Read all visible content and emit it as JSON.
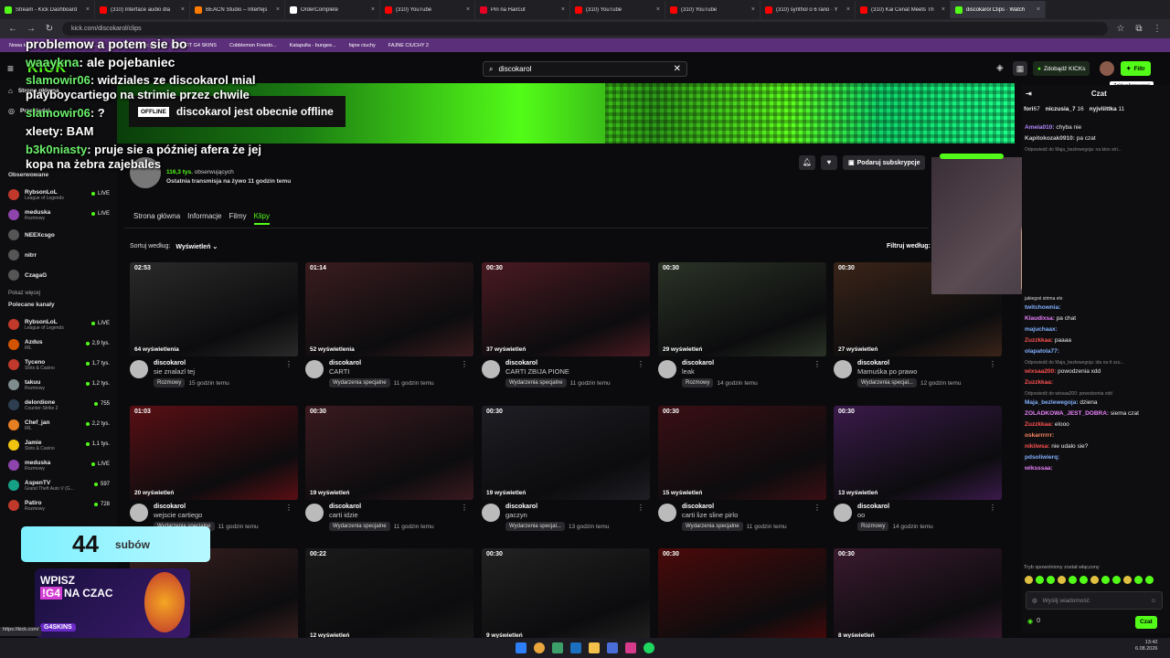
{
  "browser": {
    "tabs": [
      {
        "title": "Stream - Kick Dashboard",
        "color": "#53fc18"
      },
      {
        "title": "(310) Interface audio dla",
        "color": "#ff0000"
      },
      {
        "title": "BEACN Studio – Interfejs",
        "color": "#ff7a00"
      },
      {
        "title": "OrderComplete",
        "color": "#ffffff"
      },
      {
        "title": "(310) YouTube",
        "color": "#ff0000"
      },
      {
        "title": "Pin na Haircut",
        "color": "#e60023"
      },
      {
        "title": "(310) YouTube",
        "color": "#ff0000"
      },
      {
        "title": "(310) YouTube",
        "color": "#ff0000"
      },
      {
        "title": "(310) synthol o 6 rano · Y",
        "color": "#ff0000"
      },
      {
        "title": "(310) Kai Cenat Meets Th",
        "color": "#ff0000"
      },
      {
        "title": "discokarol Clips · Watch",
        "color": "#53fc18",
        "active": true
      }
    ],
    "url": "kick.com/discokarol/clips",
    "bookmarks": [
      "Nowa karta",
      "(644) G SHOCK HO...",
      "Imgur: The magic of...",
      "RAPORT G4 SKINS",
      "Cobblemon Freedo...",
      "Katapulta - bungee...",
      "fajne ciuchy",
      "FAJNE CIUCHY 2"
    ]
  },
  "header": {
    "logo": "KICK",
    "search_value": "discokarol",
    "subscribe_label": "Zdobądź KICKs",
    "filter_label": "Filtr",
    "tooltip": "Zaktualizowano!"
  },
  "sidebar": {
    "home": "Strona główna",
    "browse": "Przeglądaj",
    "following_label": "Obserwowane",
    "followed": [
      {
        "name": "RybsonLoL",
        "sub": "League of Legends",
        "status": "LIVE",
        "color": "#c0392b"
      },
      {
        "name": "meduska",
        "sub": "Rozmowy",
        "status": "LIVE",
        "color": "#8e44ad"
      },
      {
        "name": "NEEXcsgo",
        "sub": "",
        "status": "",
        "color": "#555"
      },
      {
        "name": "nitrr",
        "sub": "",
        "status": "",
        "color": "#555"
      },
      {
        "name": "CzagaG",
        "sub": "",
        "status": "",
        "color": "#555"
      }
    ],
    "show_more": "Pokaż więcej",
    "recommended_label": "Polecane kanały",
    "recommended": [
      {
        "name": "RybsonLoL",
        "sub": "League of Legends",
        "status": "LIVE",
        "color": "#c0392b"
      },
      {
        "name": "Azdus",
        "sub": "IRL",
        "status": "2,9 tys.",
        "color": "#d35400"
      },
      {
        "name": "Tyceno",
        "sub": "Slots & Casino",
        "status": "1,7 tys.",
        "color": "#c0392b"
      },
      {
        "name": "takuu",
        "sub": "Rozmowy",
        "status": "1,2 tys.",
        "color": "#7f8c8d"
      },
      {
        "name": "delordione",
        "sub": "Counter-Strike 2",
        "status": "755",
        "color": "#2c3e50"
      },
      {
        "name": "Chef_jan",
        "sub": "IRL",
        "status": "2,2 tys.",
        "color": "#e67e22"
      },
      {
        "name": "Jamie",
        "sub": "Slots & Casino",
        "status": "1,1 tys.",
        "color": "#f1c40f"
      },
      {
        "name": "meduska",
        "sub": "Rozmowy",
        "status": "LIVE",
        "color": "#8e44ad"
      },
      {
        "name": "AspenTV",
        "sub": "Grand Theft Auto V (G...",
        "status": "597",
        "color": "#16a085"
      },
      {
        "name": "Patiro",
        "sub": "Rozmowy",
        "status": "728",
        "color": "#c0392b"
      }
    ],
    "show_more2": "Pokaż"
  },
  "channel": {
    "offline_tag": "OFFLINE",
    "offline_text": "discokarol jest obecnie offline",
    "followers": "116,3 tys.",
    "followers_label": "obserwujących",
    "last_stream": "Ostatnia transmisja na żywo 11 godzin temu",
    "gift_label": "Podaruj subskrypcje"
  },
  "tabs": [
    "Strona główna",
    "Informacje",
    "Filmy",
    "Klipy"
  ],
  "sort": {
    "label": "Sortuj według:",
    "value": "Wyświetleń",
    "filter": "Filtruj według:"
  },
  "clips": [
    {
      "dur": "02:53",
      "views": "64 wyświetlenia",
      "channel": "discokarol",
      "title": "sie znalazl tej",
      "cat": "Rozmowy",
      "time": "15 godzin temu",
      "bg": "#2a2a2a"
    },
    {
      "dur": "01:14",
      "views": "52 wyświetlenia",
      "channel": "discokarol",
      "title": "CARTI",
      "cat": "Wydarzenia specjalne",
      "time": "11 godzin temu",
      "bg": "#3a1c1f"
    },
    {
      "dur": "00:30",
      "views": "37 wyświetleń",
      "channel": "discokarol",
      "title": "CARTI ZBIJA PIONE",
      "cat": "Wydarzenia specjalne",
      "time": "11 godzin temu",
      "bg": "#4a1a22"
    },
    {
      "dur": "00:30",
      "views": "29 wyświetleń",
      "channel": "discokarol",
      "title": "leak",
      "cat": "Rozmowy",
      "time": "14 godzin temu",
      "bg": "#2b3326"
    },
    {
      "dur": "00:30",
      "views": "27 wyświetleń",
      "channel": "discokarol",
      "title": "Mamuśka po prawo",
      "cat": "Wydarzenia specjal...",
      "time": "12 godzin temu",
      "bg": "#3a2418"
    },
    {
      "dur": "01:03",
      "views": "20 wyświetleń",
      "channel": "discokarol",
      "title": "wejscie cartiego",
      "cat": "Wydarzenia specjalne",
      "time": "11 godzin temu",
      "bg": "#5a0f14"
    },
    {
      "dur": "00:30",
      "views": "19 wyświetleń",
      "channel": "discokarol",
      "title": "carti idzie",
      "cat": "Wydarzenia specjalne",
      "time": "11 godzin temu",
      "bg": "#3a1a20"
    },
    {
      "dur": "00:30",
      "views": "19 wyświetleń",
      "channel": "discokarol",
      "title": "gaczyn",
      "cat": "Wydarzenia specjal...",
      "time": "13 godzin temu",
      "bg": "#1e1e24"
    },
    {
      "dur": "00:30",
      "views": "15 wyświetleń",
      "channel": "discokarol",
      "title": "carti lize sline pirlo",
      "cat": "Wydarzenia specjalne",
      "time": "11 godzin temu",
      "bg": "#3a0f14"
    },
    {
      "dur": "00:30",
      "views": "13 wyświetleń",
      "channel": "discokarol",
      "title": "oo",
      "cat": "Rozmowy",
      "time": "14 godzin temu",
      "bg": "#3a1a4a"
    },
    {
      "dur": "",
      "views": "14 wyświetleń",
      "channel": "",
      "title": "",
      "cat": "",
      "time": "",
      "bg": "#3a2020"
    },
    {
      "dur": "00:22",
      "views": "12 wyświetleń",
      "channel": "",
      "title": "",
      "cat": "",
      "time": "",
      "bg": "#1a1a1a"
    },
    {
      "dur": "00:30",
      "views": "9 wyświetleń",
      "channel": "",
      "title": "",
      "cat": "",
      "time": "",
      "bg": "#222"
    },
    {
      "dur": "00:30",
      "views": "",
      "channel": "",
      "title": "",
      "cat": "",
      "time": "",
      "bg": "#4a0a0a"
    },
    {
      "dur": "00:30",
      "views": "8 wyświetleń",
      "channel": "",
      "title": "",
      "cat": "",
      "time": "",
      "bg": "#3a1a2e"
    }
  ],
  "chat": {
    "title": "Czat",
    "messages": [
      {
        "user": "fori",
        "text": "67",
        "uc": "#ddd"
      },
      {
        "user": "Amela010:",
        "text": "chyba nie",
        "uc": "#b388ff"
      },
      {
        "user": "Kapitokozak0910:",
        "text": "pa czat",
        "uc": "#ccc"
      },
      {
        "user": "",
        "text": "Odpowiedź do Maja_bezlewegoja: na ktos stri...",
        "uc": "#888"
      },
      {
        "user": "",
        "text": "jakiegoś strima elo",
        "uc": "#ddd"
      },
      {
        "user": "twitchownia:",
        "text": "",
        "uc": "#82b1ff"
      },
      {
        "user": "Klaudixsa:",
        "text": "pa chat",
        "uc": "#ea80fc"
      },
      {
        "user": "majuchaax:",
        "text": "",
        "uc": "#82b1ff"
      },
      {
        "user": "Zuzzkkaa:",
        "text": "paaaa",
        "uc": "#ff5252"
      },
      {
        "user": "olapatola77:",
        "text": "",
        "uc": "#82b1ff"
      },
      {
        "user": "",
        "text": "Odpowiedź do Maja_bezlewegoja: ida na tt szu...",
        "uc": "#888"
      },
      {
        "user": "wixsaa200:",
        "text": "powodzenia xdd",
        "uc": "#ff5252"
      },
      {
        "user": "Zuzzkkaa:",
        "text": "",
        "uc": "#ff5252"
      },
      {
        "user": "",
        "text": "Odpowiedź do wixsaa200: powodzenia xdd",
        "uc": "#888"
      },
      {
        "user": "Maja_bezlewegoja:",
        "text": "dziena",
        "uc": "#82b1ff"
      },
      {
        "user": "ZOLADKOWA_JEST_DOBRA:",
        "text": "siema czat",
        "uc": "#ea80fc"
      },
      {
        "user": "Zuzzkkaa:",
        "text": "elooo",
        "uc": "#ff5252"
      },
      {
        "user": "oskarrrrrr:",
        "text": "",
        "uc": "#ff8a65"
      },
      {
        "user": "nikiiwsa:",
        "text": "nie udalo sie?",
        "uc": "#ff5252"
      },
      {
        "user": "pdsoliwierq:",
        "text": "",
        "uc": "#82b1ff"
      },
      {
        "user": "wiksssaa:",
        "text": "",
        "uc": "#ea80fc"
      }
    ],
    "top_users": [
      {
        "name": "niczusia_7",
        "n": "16"
      },
      {
        "name": "nyjvliittka",
        "n": "11"
      }
    ],
    "slow_mode": "Tryb spowolniony został włączony",
    "input_placeholder": "Wyślij wiadomość",
    "send_label": "Czat",
    "points": "0"
  },
  "overlay": {
    "lines": [
      {
        "user": "",
        "text": "problemow a potem sie bo"
      },
      {
        "user": "waaykna",
        "text": "ale pojebaniec"
      },
      {
        "user": "slamowir06",
        "text": "widziales ze discokarol mial playboycartiego na strimie przez chwile"
      },
      {
        "user": "slamowir06",
        "text": "?"
      },
      {
        "user": "",
        "text": "xleety: BAM"
      },
      {
        "user": "b3k0niasty",
        "text": "pruje sie a później afera że jej kopa na żebra zajebales"
      }
    ],
    "sub_count": "44",
    "sub_label": "subów",
    "promo_top": "WPISZ",
    "promo_code": "!G4",
    "promo_tail": "NA CZAC",
    "promo_brand": "G4SKINS"
  },
  "status_url": "https://kick.com/",
  "clock": {
    "time": "13:42",
    "date": "6.08.2026"
  },
  "colors": {
    "accent": "#53fc18",
    "bg": "#0b0b0d",
    "panel": "#0e0e10",
    "bookmark_bar": "#5c2f7a"
  }
}
